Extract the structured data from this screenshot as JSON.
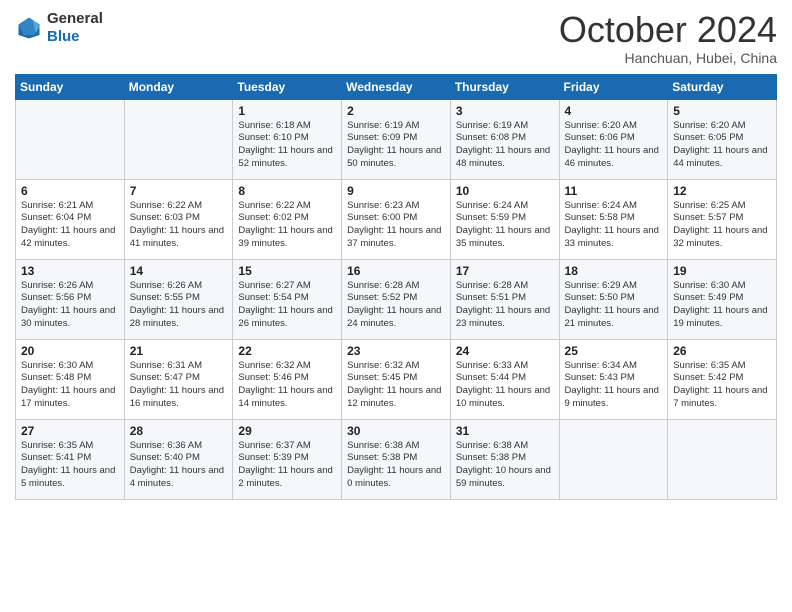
{
  "header": {
    "logo_general": "General",
    "logo_blue": "Blue",
    "month": "October 2024",
    "location": "Hanchuan, Hubei, China"
  },
  "weekdays": [
    "Sunday",
    "Monday",
    "Tuesday",
    "Wednesday",
    "Thursday",
    "Friday",
    "Saturday"
  ],
  "weeks": [
    [
      {
        "day": "",
        "detail": ""
      },
      {
        "day": "",
        "detail": ""
      },
      {
        "day": "1",
        "detail": "Sunrise: 6:18 AM\nSunset: 6:10 PM\nDaylight: 11 hours and 52 minutes."
      },
      {
        "day": "2",
        "detail": "Sunrise: 6:19 AM\nSunset: 6:09 PM\nDaylight: 11 hours and 50 minutes."
      },
      {
        "day": "3",
        "detail": "Sunrise: 6:19 AM\nSunset: 6:08 PM\nDaylight: 11 hours and 48 minutes."
      },
      {
        "day": "4",
        "detail": "Sunrise: 6:20 AM\nSunset: 6:06 PM\nDaylight: 11 hours and 46 minutes."
      },
      {
        "day": "5",
        "detail": "Sunrise: 6:20 AM\nSunset: 6:05 PM\nDaylight: 11 hours and 44 minutes."
      }
    ],
    [
      {
        "day": "6",
        "detail": "Sunrise: 6:21 AM\nSunset: 6:04 PM\nDaylight: 11 hours and 42 minutes."
      },
      {
        "day": "7",
        "detail": "Sunrise: 6:22 AM\nSunset: 6:03 PM\nDaylight: 11 hours and 41 minutes."
      },
      {
        "day": "8",
        "detail": "Sunrise: 6:22 AM\nSunset: 6:02 PM\nDaylight: 11 hours and 39 minutes."
      },
      {
        "day": "9",
        "detail": "Sunrise: 6:23 AM\nSunset: 6:00 PM\nDaylight: 11 hours and 37 minutes."
      },
      {
        "day": "10",
        "detail": "Sunrise: 6:24 AM\nSunset: 5:59 PM\nDaylight: 11 hours and 35 minutes."
      },
      {
        "day": "11",
        "detail": "Sunrise: 6:24 AM\nSunset: 5:58 PM\nDaylight: 11 hours and 33 minutes."
      },
      {
        "day": "12",
        "detail": "Sunrise: 6:25 AM\nSunset: 5:57 PM\nDaylight: 11 hours and 32 minutes."
      }
    ],
    [
      {
        "day": "13",
        "detail": "Sunrise: 6:26 AM\nSunset: 5:56 PM\nDaylight: 11 hours and 30 minutes."
      },
      {
        "day": "14",
        "detail": "Sunrise: 6:26 AM\nSunset: 5:55 PM\nDaylight: 11 hours and 28 minutes."
      },
      {
        "day": "15",
        "detail": "Sunrise: 6:27 AM\nSunset: 5:54 PM\nDaylight: 11 hours and 26 minutes."
      },
      {
        "day": "16",
        "detail": "Sunrise: 6:28 AM\nSunset: 5:52 PM\nDaylight: 11 hours and 24 minutes."
      },
      {
        "day": "17",
        "detail": "Sunrise: 6:28 AM\nSunset: 5:51 PM\nDaylight: 11 hours and 23 minutes."
      },
      {
        "day": "18",
        "detail": "Sunrise: 6:29 AM\nSunset: 5:50 PM\nDaylight: 11 hours and 21 minutes."
      },
      {
        "day": "19",
        "detail": "Sunrise: 6:30 AM\nSunset: 5:49 PM\nDaylight: 11 hours and 19 minutes."
      }
    ],
    [
      {
        "day": "20",
        "detail": "Sunrise: 6:30 AM\nSunset: 5:48 PM\nDaylight: 11 hours and 17 minutes."
      },
      {
        "day": "21",
        "detail": "Sunrise: 6:31 AM\nSunset: 5:47 PM\nDaylight: 11 hours and 16 minutes."
      },
      {
        "day": "22",
        "detail": "Sunrise: 6:32 AM\nSunset: 5:46 PM\nDaylight: 11 hours and 14 minutes."
      },
      {
        "day": "23",
        "detail": "Sunrise: 6:32 AM\nSunset: 5:45 PM\nDaylight: 11 hours and 12 minutes."
      },
      {
        "day": "24",
        "detail": "Sunrise: 6:33 AM\nSunset: 5:44 PM\nDaylight: 11 hours and 10 minutes."
      },
      {
        "day": "25",
        "detail": "Sunrise: 6:34 AM\nSunset: 5:43 PM\nDaylight: 11 hours and 9 minutes."
      },
      {
        "day": "26",
        "detail": "Sunrise: 6:35 AM\nSunset: 5:42 PM\nDaylight: 11 hours and 7 minutes."
      }
    ],
    [
      {
        "day": "27",
        "detail": "Sunrise: 6:35 AM\nSunset: 5:41 PM\nDaylight: 11 hours and 5 minutes."
      },
      {
        "day": "28",
        "detail": "Sunrise: 6:36 AM\nSunset: 5:40 PM\nDaylight: 11 hours and 4 minutes."
      },
      {
        "day": "29",
        "detail": "Sunrise: 6:37 AM\nSunset: 5:39 PM\nDaylight: 11 hours and 2 minutes."
      },
      {
        "day": "30",
        "detail": "Sunrise: 6:38 AM\nSunset: 5:38 PM\nDaylight: 11 hours and 0 minutes."
      },
      {
        "day": "31",
        "detail": "Sunrise: 6:38 AM\nSunset: 5:38 PM\nDaylight: 10 hours and 59 minutes."
      },
      {
        "day": "",
        "detail": ""
      },
      {
        "day": "",
        "detail": ""
      }
    ]
  ]
}
